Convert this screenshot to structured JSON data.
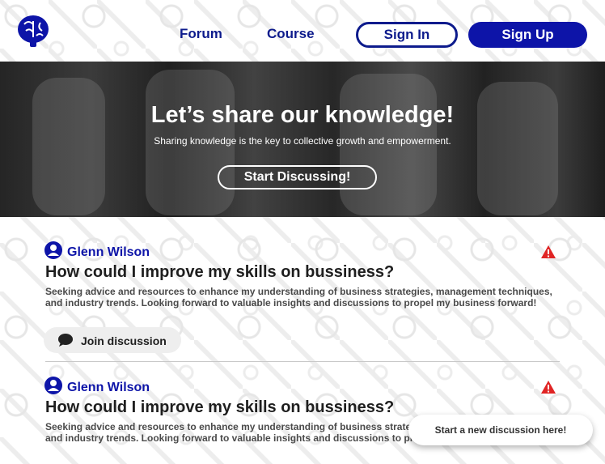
{
  "header": {
    "nav": [
      {
        "label": "Forum"
      },
      {
        "label": "Course"
      }
    ],
    "signin_label": "Sign In",
    "signup_label": "Sign Up",
    "logo_icon": "brain-icon"
  },
  "hero": {
    "title": "Let’s share our knowledge!",
    "subtitle": "Sharing knowledge is the key to collective growth and empowerment.",
    "cta_label": "Start Discussing!"
  },
  "posts": [
    {
      "author": "Glenn Wilson",
      "title": "How could I improve my skills on bussiness?",
      "body": "Seeking advice and resources to enhance my understanding of business strategies, management techniques, and industry trends. Looking forward to valuable insights and discussions to propel my business forward!",
      "join_label": "Join discussion"
    },
    {
      "author": "Glenn Wilson",
      "title": "How could I improve my skills on bussiness?",
      "body": "Seeking advice and resources to enhance my understanding of business strategies, management techniques, and industry trends. Looking forward to valuable insights and discussions to propel my business forward!"
    }
  ],
  "floating_cta": "Start a new discussion here!",
  "colors": {
    "brand": "#0d14a8",
    "nav_text": "#0d1b8c",
    "warning": "#e02424"
  }
}
